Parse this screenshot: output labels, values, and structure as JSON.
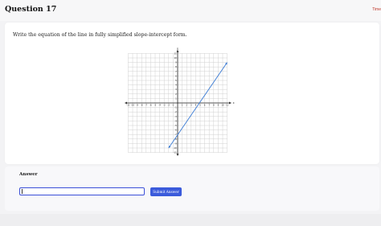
{
  "header": {
    "question_title": "Question 17",
    "timer_label": "Time"
  },
  "prompt": "Write the equation of the line in fully simplified slope-intercept form.",
  "graph": {
    "x_range": [
      -11,
      11
    ],
    "y_range": [
      -11,
      11
    ],
    "tick_labels": [
      -11,
      -10,
      -9,
      -8,
      -7,
      -6,
      -5,
      -4,
      -3,
      -2,
      -1,
      1,
      2,
      3,
      4,
      5,
      6,
      7,
      8,
      9,
      10,
      11
    ],
    "axis_symbols": {
      "x": "x",
      "y": "y"
    },
    "line": {
      "from": [
        -2,
        -10
      ],
      "to": [
        11,
        9
      ],
      "color": "#3a7bd5"
    },
    "grid": true
  },
  "answer": {
    "label": "Answer",
    "input_value": "",
    "submit_label": "Submit Answer"
  },
  "colors": {
    "accent": "#3b5bdb",
    "line": "#3a7bd5",
    "timer": "#c0392b"
  }
}
